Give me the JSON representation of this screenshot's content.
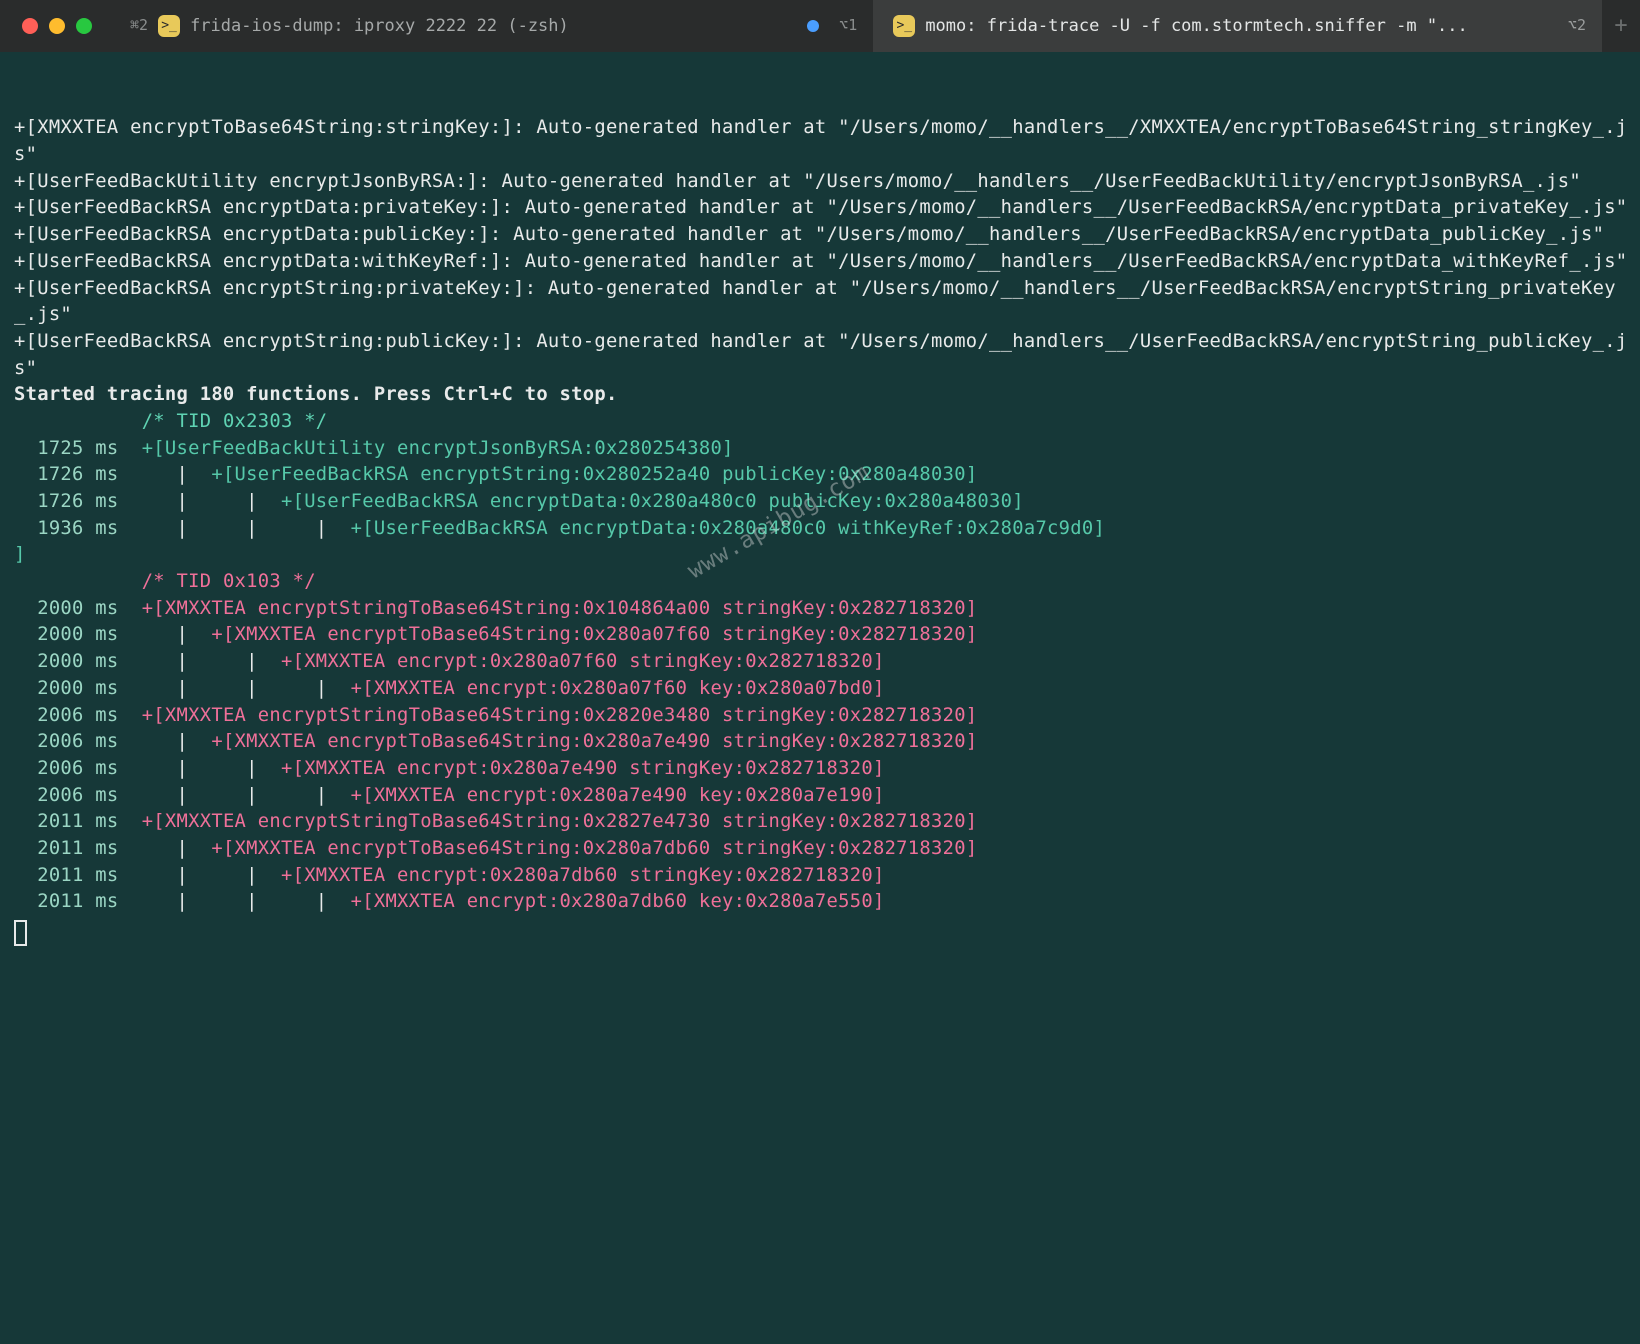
{
  "titlebar": {
    "tab1": {
      "kbd": "⌘2",
      "title": "frida-ios-dump: iproxy 2222 22 (-zsh)",
      "right_kbd": "⌥1"
    },
    "tab2": {
      "title": "momo: frida-trace -U -f com.stormtech.sniffer -m \"...",
      "right_kbd": "⌥2"
    }
  },
  "handlers": [
    "+[XMXXTEA encryptToBase64String:stringKey:]: Auto-generated handler at \"/Users/momo/__handlers__/XMXXTEA/encryptToBase64String_stringKey_.js\"",
    "+[UserFeedBackUtility encryptJsonByRSA:]: Auto-generated handler at \"/Users/momo/__handlers__/UserFeedBackUtility/encryptJsonByRSA_.js\"",
    "+[UserFeedBackRSA encryptData:privateKey:]: Auto-generated handler at \"/Users/momo/__handlers__/UserFeedBackRSA/encryptData_privateKey_.js\"",
    "+[UserFeedBackRSA encryptData:publicKey:]: Auto-generated handler at \"/Users/momo/__handlers__/UserFeedBackRSA/encryptData_publicKey_.js\"",
    "+[UserFeedBackRSA encryptData:withKeyRef:]: Auto-generated handler at \"/Users/momo/__handlers__/UserFeedBackRSA/encryptData_withKeyRef_.js\"",
    "+[UserFeedBackRSA encryptString:privateKey:]: Auto-generated handler at \"/Users/momo/__handlers__/UserFeedBackRSA/encryptString_privateKey_.js\"",
    "+[UserFeedBackRSA encryptString:publicKey:]: Auto-generated handler at \"/Users/momo/__handlers__/UserFeedBackRSA/encryptString_publicKey_.js\""
  ],
  "started": "Started tracing 180 functions. Press Ctrl+C to stop.",
  "tid1": "/* TID 0x2303 */",
  "teal_rows": [
    {
      "ts": "  1725 ms  ",
      "body": "+[UserFeedBackUtility encryptJsonByRSA:0x280254380]"
    },
    {
      "ts": "  1726 ms  ",
      "pre": "   |  ",
      "body": "+[UserFeedBackRSA encryptString:0x280252a40 publicKey:0x280a48030]"
    },
    {
      "ts": "  1726 ms  ",
      "pre": "   |     |  ",
      "body": "+[UserFeedBackRSA encryptData:0x280a480c0 publicKey:0x280a48030]"
    },
    {
      "ts": "  1936 ms  ",
      "pre": "   |     |     |  ",
      "body": "+[UserFeedBackRSA encryptData:0x280a480c0 withKeyRef:0x280a7c9d0]"
    }
  ],
  "tid2": "/* TID 0x103 */",
  "pink_rows": [
    {
      "ts": "  2000 ms  ",
      "body": "+[XMXXTEA encryptStringToBase64String:0x104864a00 stringKey:0x282718320]"
    },
    {
      "ts": "  2000 ms  ",
      "pre": "   |  ",
      "body": "+[XMXXTEA encryptToBase64String:0x280a07f60 stringKey:0x282718320]"
    },
    {
      "ts": "  2000 ms  ",
      "pre": "   |     |  ",
      "body": "+[XMXXTEA encrypt:0x280a07f60 stringKey:0x282718320]"
    },
    {
      "ts": "  2000 ms  ",
      "pre": "   |     |     |  ",
      "body": "+[XMXXTEA encrypt:0x280a07f60 key:0x280a07bd0]"
    },
    {
      "ts": "  2006 ms  ",
      "body": "+[XMXXTEA encryptStringToBase64String:0x2820e3480 stringKey:0x282718320]"
    },
    {
      "ts": "  2006 ms  ",
      "pre": "   |  ",
      "body": "+[XMXXTEA encryptToBase64String:0x280a7e490 stringKey:0x282718320]"
    },
    {
      "ts": "  2006 ms  ",
      "pre": "   |     |  ",
      "body": "+[XMXXTEA encrypt:0x280a7e490 stringKey:0x282718320]"
    },
    {
      "ts": "  2006 ms  ",
      "pre": "   |     |     |  ",
      "body": "+[XMXXTEA encrypt:0x280a7e490 key:0x280a7e190]"
    },
    {
      "ts": "  2011 ms  ",
      "body": "+[XMXXTEA encryptStringToBase64String:0x2827e4730 stringKey:0x282718320]"
    },
    {
      "ts": "  2011 ms  ",
      "pre": "   |  ",
      "body": "+[XMXXTEA encryptToBase64String:0x280a7db60 stringKey:0x282718320]"
    },
    {
      "ts": "  2011 ms  ",
      "pre": "   |     |  ",
      "body": "+[XMXXTEA encrypt:0x280a7db60 stringKey:0x282718320]"
    },
    {
      "ts": "  2011 ms  ",
      "pre": "   |     |     |  ",
      "body": "+[XMXXTEA encrypt:0x280a7db60 key:0x280a7e550]"
    }
  ],
  "watermark": "www.apibug.com"
}
